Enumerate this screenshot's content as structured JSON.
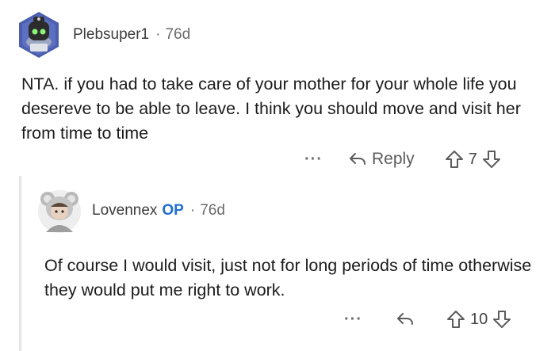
{
  "comments": [
    {
      "author": "Plebsuper1",
      "age": "76d",
      "separator": "·",
      "text": "NTA. if you had to take care of your mother for your whole life you desereve to be able to leave. I think you should move and visit her from time to time",
      "actions": {
        "more": "···",
        "reply_label": "Reply",
        "score": "7"
      }
    },
    {
      "author": "Lovennex",
      "badge": "OP",
      "age": "76d",
      "separator": "·",
      "text": "Of course I would visit, just not for long periods of time otherwise they would put me right to work.",
      "actions": {
        "more": "···",
        "score": "10"
      }
    }
  ],
  "colors": {
    "op_badge": "#1f6fd1",
    "text": "#1c1c1c",
    "meta": "#6a6a6a"
  },
  "icons": [
    "reply-arrow-icon",
    "upvote-arrow-icon",
    "downvote-arrow-icon",
    "more-options-icon"
  ]
}
